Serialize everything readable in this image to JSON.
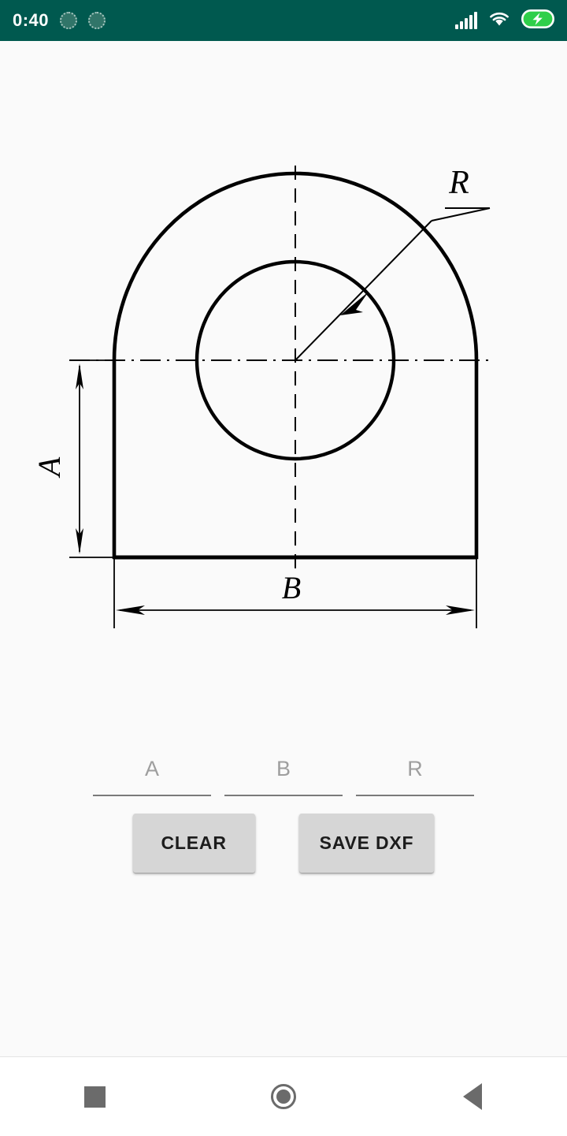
{
  "status_bar": {
    "clock": "0:40",
    "background_color": "#00594F",
    "notification_icons": [
      "notification-dot",
      "notification-dot"
    ],
    "right_icons": [
      "signal-bars-icon",
      "wifi-icon",
      "battery-charging-icon"
    ]
  },
  "drawing": {
    "title": "arch-plate-technical-drawing",
    "labels": {
      "height": "A",
      "width": "B",
      "radius": "R"
    },
    "line_color": "#000000",
    "background_color": "#FAFAFA"
  },
  "inputs": [
    {
      "name": "input-a",
      "hint": "A",
      "value": ""
    },
    {
      "name": "input-b",
      "hint": "B",
      "value": ""
    },
    {
      "name": "input-r",
      "hint": "R",
      "value": ""
    }
  ],
  "buttons": {
    "clear": "CLEAR",
    "save": "SAVE DXF",
    "background_color": "#D6D6D6"
  },
  "nav_bar": {
    "recents": "recents-square-icon",
    "home": "home-circle-icon",
    "back": "back-triangle-icon"
  }
}
